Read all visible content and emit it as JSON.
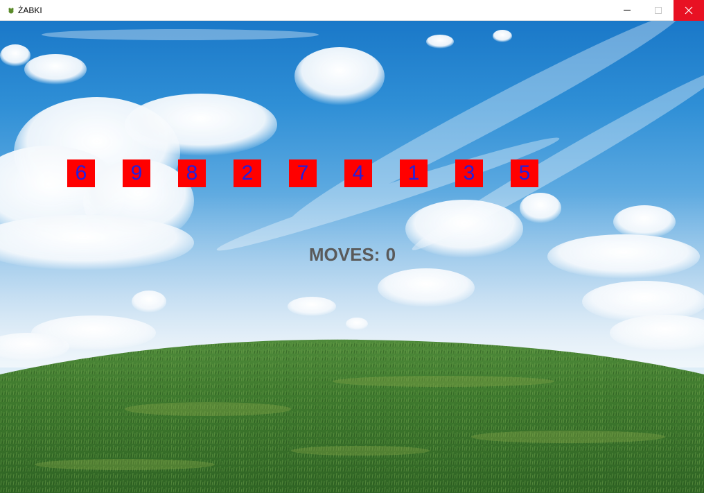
{
  "window": {
    "title": "ŻABKI",
    "icon": "frog-icon",
    "controls": {
      "minimize": "—",
      "maximize": "☐",
      "close": "✕"
    }
  },
  "game": {
    "tiles": [
      "6",
      "9",
      "8",
      "2",
      "7",
      "4",
      "1",
      "3",
      "5"
    ],
    "moves_label": "MOVES:",
    "moves_count": "0"
  },
  "colors": {
    "tile_bg": "#ff0000",
    "tile_text": "#2020e0",
    "moves_text": "#5a5a5a",
    "close_button": "#e81123"
  }
}
